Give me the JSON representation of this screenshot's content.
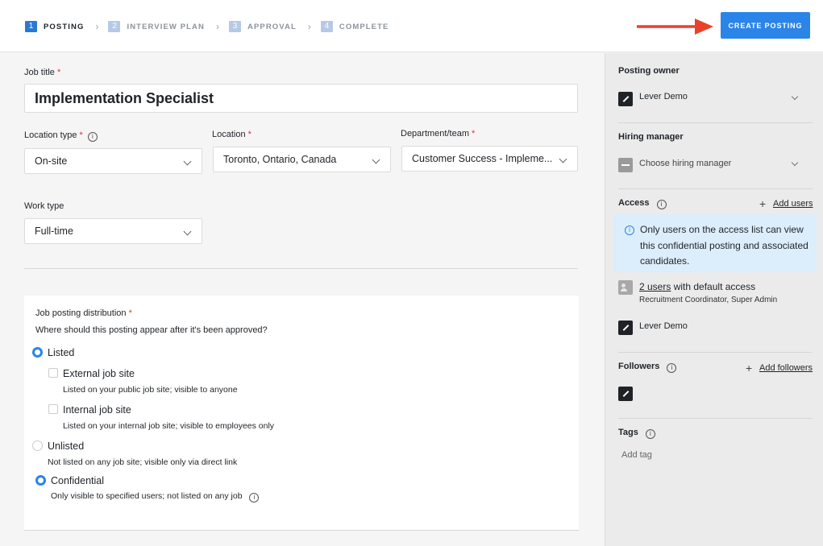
{
  "steps": [
    {
      "num": "1",
      "label": "POSTING"
    },
    {
      "num": "2",
      "label": "INTERVIEW PLAN"
    },
    {
      "num": "3",
      "label": "APPROVAL"
    },
    {
      "num": "4",
      "label": "COMPLETE"
    }
  ],
  "header": {
    "create_label": "CREATE POSTING"
  },
  "form": {
    "job_title_label": "Job title",
    "job_title_value": "Implementation Specialist",
    "location_type_label": "Location type",
    "location_type_value": "On-site",
    "location_label": "Location",
    "location_value": "Toronto, Ontario, Canada",
    "department_label": "Department/team",
    "department_value": "Customer Success - Impleme...",
    "work_type_label": "Work type",
    "work_type_value": "Full-time",
    "required_mark": "*",
    "info_glyph": "i"
  },
  "distribution": {
    "title": "Job posting distribution",
    "question": "Where should this posting appear after it's been approved?",
    "listed_label": "Listed",
    "external_label": "External job site",
    "external_desc": "Listed on your public job site; visible to anyone",
    "internal_label": "Internal job site",
    "internal_desc": "Listed on your internal job site; visible to employees only",
    "unlisted_label": "Unlisted",
    "unlisted_desc": "Not listed on any job site; visible only via direct link",
    "confidential_label": "Confidential",
    "confidential_desc": "Only visible to specified users; not listed on any job"
  },
  "sidebar": {
    "owner_heading": "Posting owner",
    "owner_name": "Lever Demo",
    "hiring_heading": "Hiring manager",
    "hiring_placeholder": "Choose hiring manager",
    "access_heading": "Access",
    "add_users": "Add users",
    "notice": "Only users on the access list can view this confidential posting and associated candidates.",
    "users_link": "2 users",
    "users_suffix": " with default access",
    "users_roles": "Recruitment Coordinator, Super Admin",
    "access_member": "Lever Demo",
    "followers_heading": "Followers",
    "add_followers": "Add followers",
    "tags_heading": "Tags",
    "tags_placeholder": "Add tag",
    "plus_glyph": "+"
  },
  "colors": {
    "accent": "#2b84e8",
    "annotation_arrow": "#e8412c",
    "notice_bg": "#dcedfc"
  },
  "icons": [
    "chevron-right-icon",
    "chevron-down-icon",
    "info-icon",
    "avatar-icon",
    "users-icon",
    "plus-icon",
    "red-arrow-annotation"
  ]
}
